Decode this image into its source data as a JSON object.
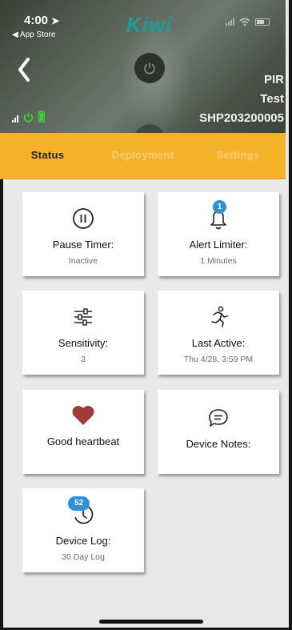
{
  "status_bar": {
    "time": "4:00",
    "back_to_app": "◀ App Store"
  },
  "brand": "Kiwi",
  "device": {
    "type": "PIR",
    "name": "Test",
    "serial": "SHP203200005"
  },
  "tabs": [
    {
      "label": "Status",
      "active": true
    },
    {
      "label": "Deployment",
      "active": false
    },
    {
      "label": "Settings",
      "active": false
    }
  ],
  "cards": {
    "pause_timer": {
      "title": "Pause Timer:",
      "value": "Inactive",
      "icon": "pause-icon"
    },
    "alert_limiter": {
      "title": "Alert Limiter:",
      "value": "1 Minutes",
      "badge": "1",
      "icon": "bell-icon"
    },
    "sensitivity": {
      "title": "Sensitivity:",
      "value": "3",
      "icon": "sliders-icon"
    },
    "last_active": {
      "title": "Last Active:",
      "value": "Thu 4/28, 3:59 PM",
      "icon": "running-icon"
    },
    "heartbeat": {
      "title": "Good heartbeat",
      "icon": "heart-icon"
    },
    "device_notes": {
      "title": "Device Notes:",
      "icon": "speech-bubble-icon"
    },
    "device_log": {
      "title": "Device Log:",
      "value": "30 Day Log",
      "badge": "52",
      "icon": "history-icon"
    }
  },
  "colors": {
    "accent": "#f4b228",
    "brand": "#1aa093",
    "badge": "#2f8fd8",
    "heart": "#a23a3a",
    "status_green": "#3bd13b"
  }
}
